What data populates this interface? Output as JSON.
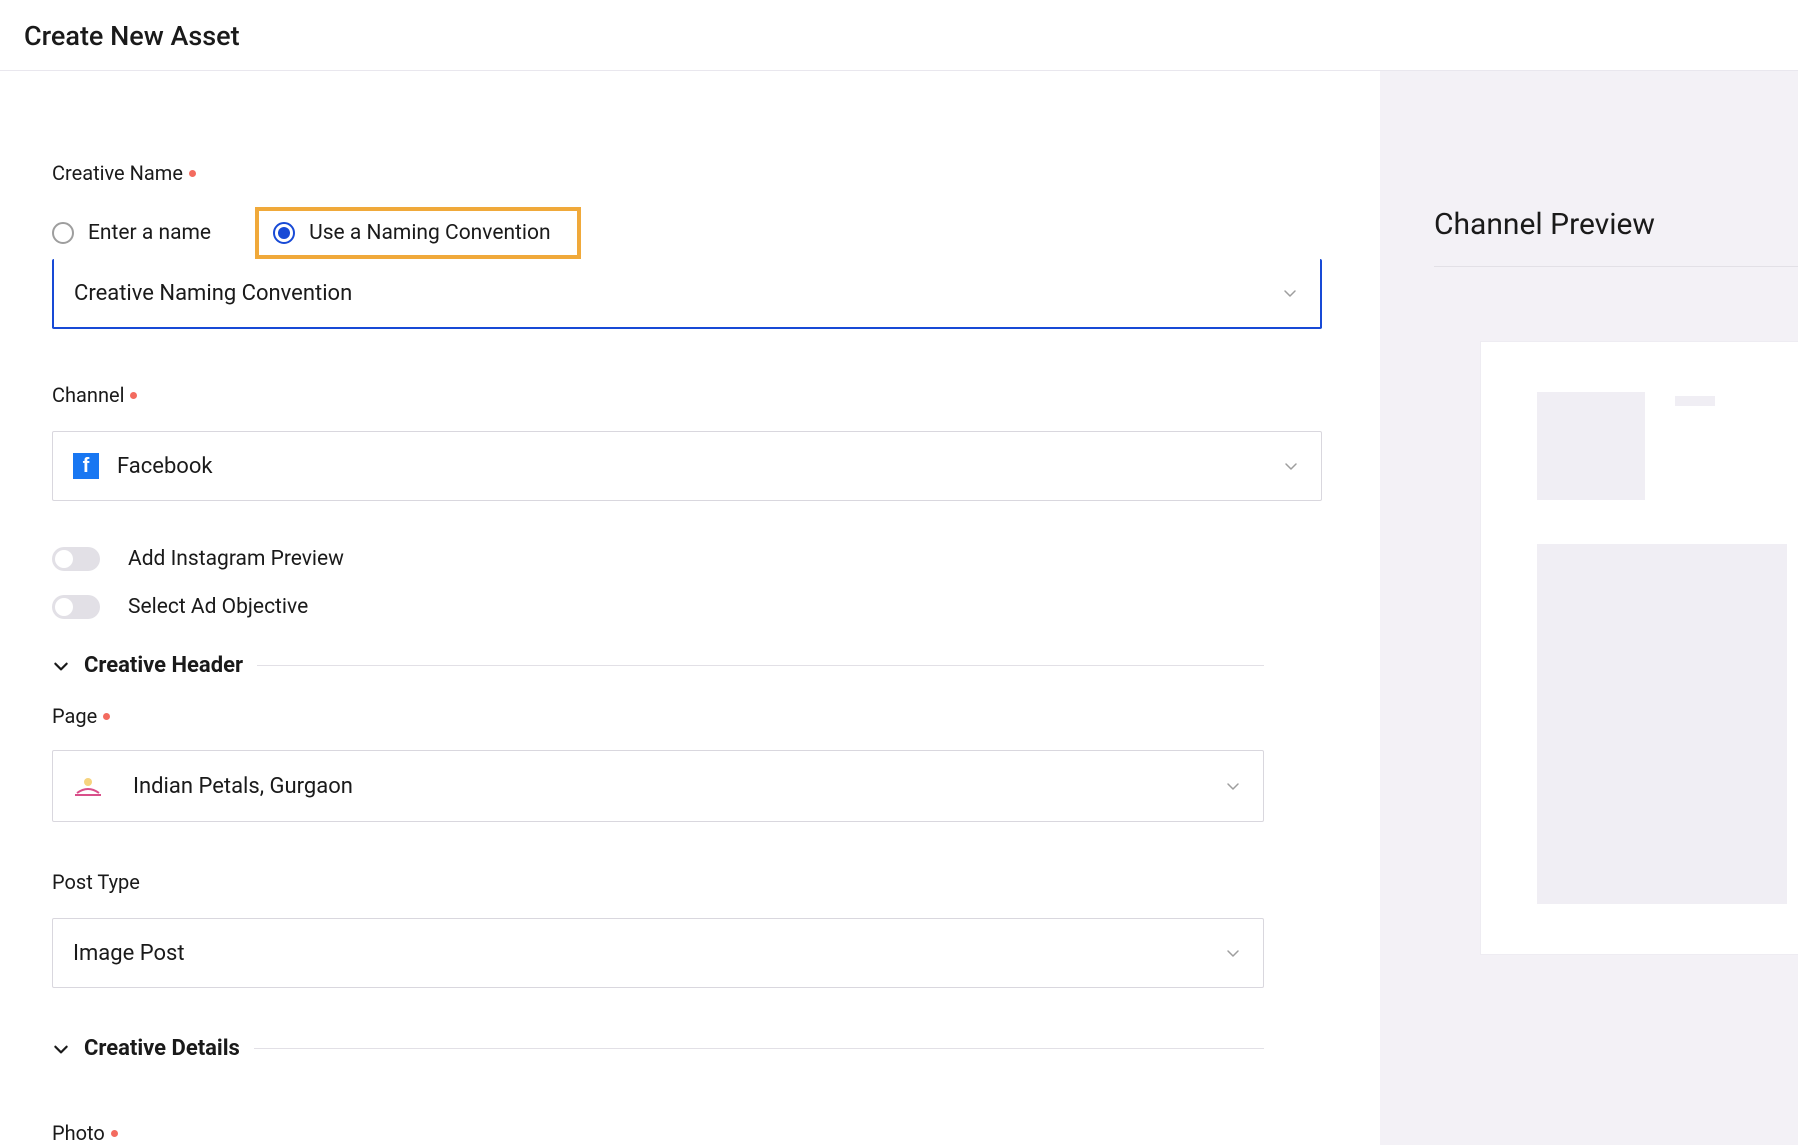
{
  "header": {
    "title": "Create New Asset"
  },
  "creativeName": {
    "label": "Creative Name",
    "option_enter": "Enter a name",
    "option_convention": "Use a Naming Convention",
    "select_placeholder": "Creative Naming Convention"
  },
  "channel": {
    "label": "Channel",
    "value": "Facebook"
  },
  "toggles": {
    "instagram": "Add Instagram Preview",
    "objective": "Select Ad Objective"
  },
  "sections": {
    "creative_header": "Creative Header",
    "creative_details": "Creative Details"
  },
  "page": {
    "label": "Page",
    "value": "Indian Petals, Gurgaon"
  },
  "postType": {
    "label": "Post Type",
    "value": "Image Post"
  },
  "photo": {
    "label": "Photo"
  },
  "preview": {
    "title": "Channel Preview"
  }
}
